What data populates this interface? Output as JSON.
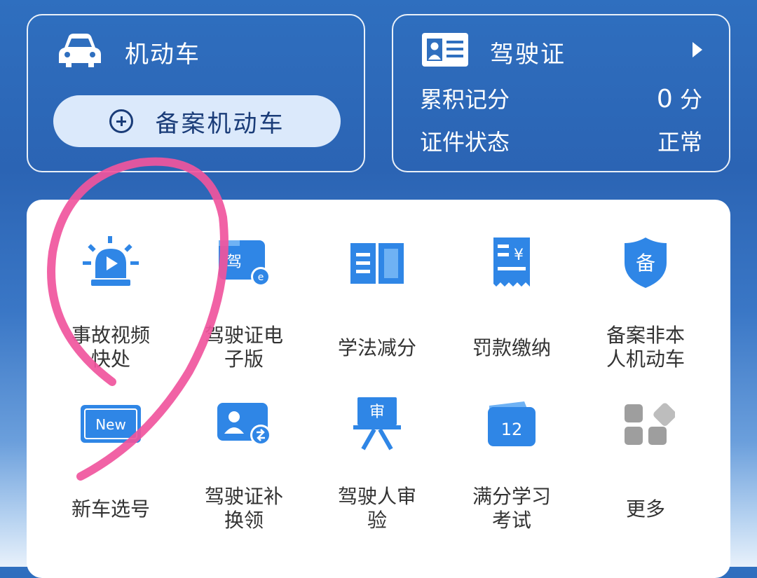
{
  "vehicle": {
    "title": "机动车",
    "register_button": "备案机动车"
  },
  "license": {
    "title": "驾驶证",
    "points_label": "累积记分",
    "points_value": "0",
    "points_unit": "分",
    "status_label": "证件状态",
    "status_value": "正常"
  },
  "services": {
    "row1": [
      {
        "label": "事故视频快处",
        "icon": "alarm-video-icon"
      },
      {
        "label": "驾驶证电子版",
        "icon": "e-license-icon",
        "badge": "驾"
      },
      {
        "label": "学法减分",
        "icon": "book-icon"
      },
      {
        "label": "罚款缴纳",
        "icon": "receipt-yen-icon",
        "badge": "¥"
      },
      {
        "label": "备案非本人机动车",
        "icon": "shield-icon",
        "badge": "备"
      }
    ],
    "row2": [
      {
        "label": "新车选号",
        "icon": "new-plate-icon",
        "badge": "New"
      },
      {
        "label": "驾驶证补换领",
        "icon": "license-exchange-icon"
      },
      {
        "label": "驾驶人审验",
        "icon": "review-board-icon",
        "badge": "审"
      },
      {
        "label": "满分学习考试",
        "icon": "calendar-icon",
        "badge": "12"
      },
      {
        "label": "更多",
        "icon": "more-grid-icon"
      }
    ]
  },
  "colors": {
    "brand_blue": "#2f86e6",
    "annotation_pink": "#f0559d"
  }
}
